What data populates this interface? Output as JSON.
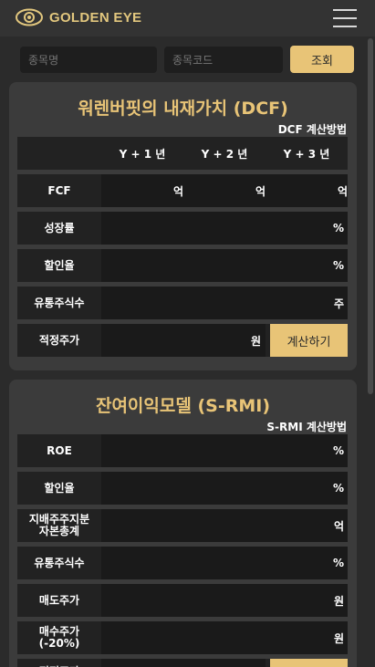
{
  "header": {
    "brand": "GOLDEN EYE",
    "logo_icon": "eye-logo-icon",
    "menu_icon": "hamburger-menu-icon",
    "brand_color": "#e8c477"
  },
  "search": {
    "name_placeholder": "종목명",
    "code_placeholder": "종목코드",
    "submit_label": "조회"
  },
  "dcf": {
    "title": "워렌버핏의 내재가치 (DCF)",
    "method_link": "DCF 계산방법",
    "years": [
      "Y + 1 년",
      "Y + 2 년",
      "Y + 3 년"
    ],
    "fcf": {
      "label": "FCF",
      "units": [
        "억",
        "억",
        "억"
      ]
    },
    "growth": {
      "label": "성장률",
      "unit": "%"
    },
    "discount": {
      "label": "할인율",
      "unit": "%"
    },
    "shares": {
      "label": "유통주식수",
      "unit": "주"
    },
    "fair_price": {
      "label": "적정주가",
      "unit": "원"
    },
    "calc_button": "계산하기"
  },
  "srim": {
    "title": "잔여이익모델 (S-RMI)",
    "method_link": "S-RMI 계산방법",
    "rows": [
      {
        "label": "ROE",
        "unit": "%"
      },
      {
        "label": "할인율",
        "unit": "%"
      },
      {
        "label_line1": "지배주주지분",
        "label_line2": "자본총계",
        "unit": "억"
      },
      {
        "label": "유통주식수",
        "unit": "%"
      },
      {
        "label": "매도주가",
        "unit": "원"
      },
      {
        "label_line1": "매수주가",
        "label_line2": "(-20%)",
        "unit": "원"
      },
      {
        "label": "적정주가"
      }
    ]
  }
}
